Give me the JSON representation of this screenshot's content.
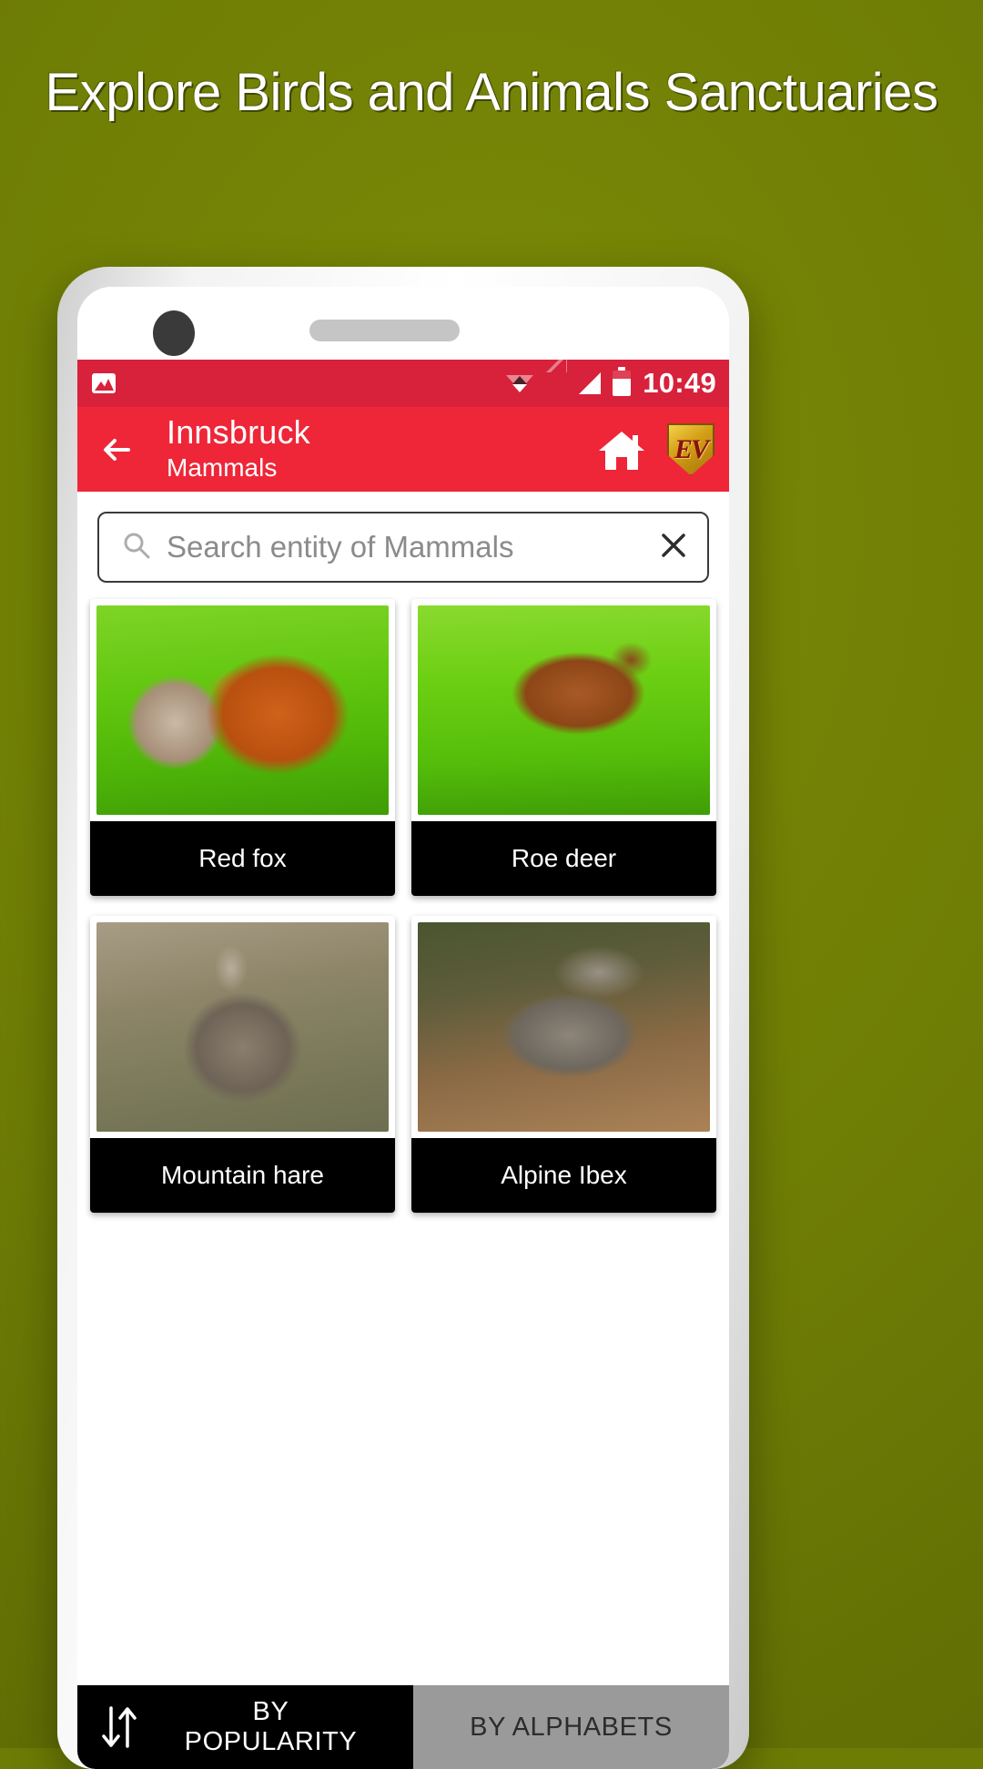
{
  "headline": "Explore Birds and Animals Sanctuaries",
  "theme": {
    "background": "#6d7c05",
    "appbar": "#ee2638",
    "statusbar": "#d8213a",
    "label_bar": "#000000",
    "inactive_tab": "#9a9a9a"
  },
  "statusbar": {
    "photo_icon": "photo-icon",
    "wifi_icon": "wifi-icon",
    "signal_icon_1": "signal-hollow-icon",
    "signal_icon_2": "signal-full-icon",
    "battery_icon": "battery-icon",
    "time": "10:49"
  },
  "appbar": {
    "back_icon": "back-arrow-icon",
    "title": "Innsbruck",
    "subtitle": "Mammals",
    "home_icon": "home-icon",
    "logo_text": "EV"
  },
  "search": {
    "icon": "search-icon",
    "value": "",
    "placeholder": "Search entity of Mammals",
    "clear_icon": "close-icon"
  },
  "grid": {
    "items": [
      {
        "label": "Red fox",
        "art": "ph-fox"
      },
      {
        "label": "Roe deer",
        "art": "ph-deer"
      },
      {
        "label": "Mountain hare",
        "art": "ph-hare"
      },
      {
        "label": "Alpine Ibex",
        "art": "ph-ibex"
      }
    ]
  },
  "sortbar": {
    "sort_icon": "sort-arrows-icon",
    "popularity_label": "BY POPULARITY",
    "alphabets_label": "BY ALPHABETS"
  }
}
